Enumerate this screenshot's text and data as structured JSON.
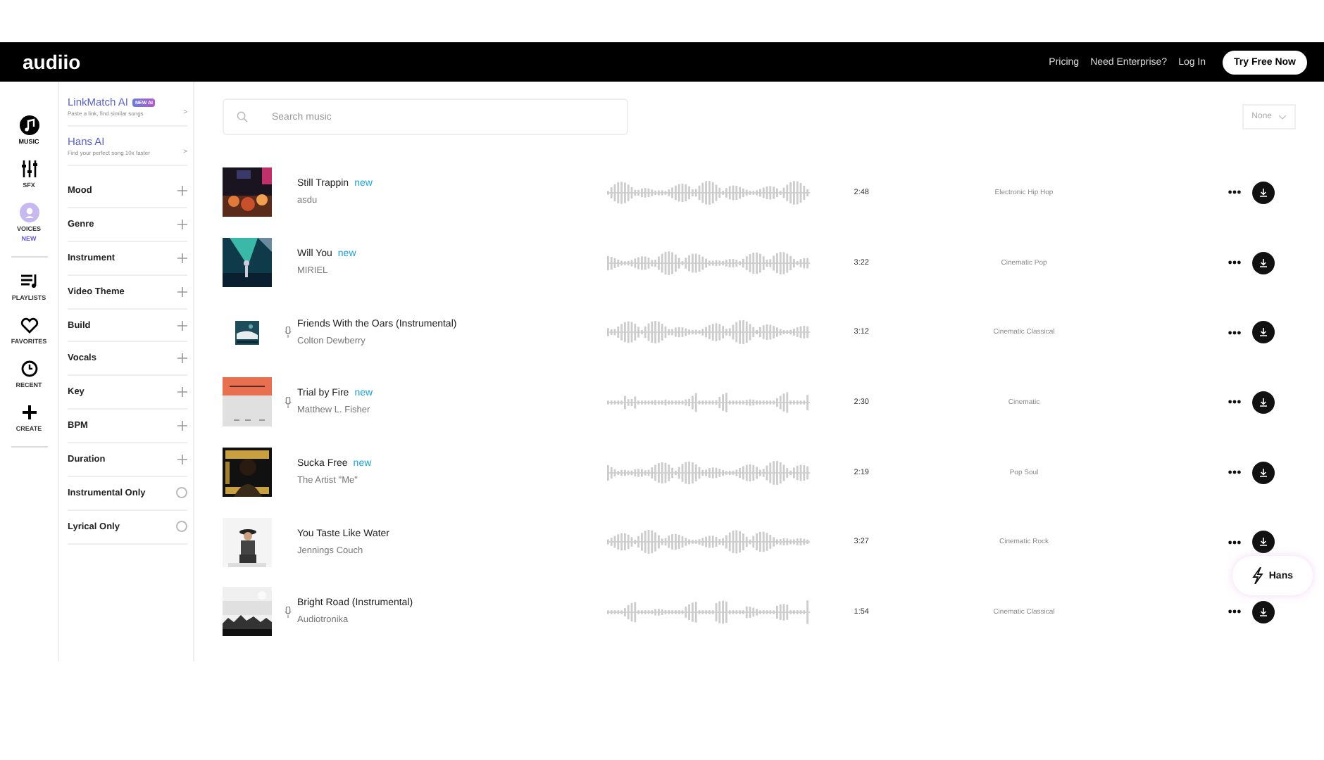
{
  "header": {
    "logo": "audiio",
    "links": [
      "Pricing",
      "Need Enterprise?",
      "Log In"
    ],
    "cta": "Try Free Now"
  },
  "nav_rail": [
    {
      "label": "MUSIC",
      "selected": true
    },
    {
      "label": "SFX",
      "selected": false
    },
    {
      "label": "VOICES",
      "selected": false,
      "tag": "NEW"
    },
    {
      "label": "PLAYLISTS",
      "selected": false
    },
    {
      "label": "FAVORITES",
      "selected": false
    },
    {
      "label": "RECENT",
      "selected": false
    },
    {
      "label": "CREATE",
      "selected": false
    }
  ],
  "ai_tools": [
    {
      "title": "LinkMatch AI",
      "badge": "NEW AI",
      "subtitle": "Paste a link, find similar songs",
      "chevron": ">"
    },
    {
      "title": "Hans AI",
      "subtitle": "Find your perfect song 10x faster",
      "chevron": ">"
    }
  ],
  "filters": [
    {
      "label": "Mood",
      "kind": "expand"
    },
    {
      "label": "Genre",
      "kind": "expand"
    },
    {
      "label": "Instrument",
      "kind": "expand"
    },
    {
      "label": "Video Theme",
      "kind": "expand"
    },
    {
      "label": "Build",
      "kind": "expand"
    },
    {
      "label": "Vocals",
      "kind": "expand"
    },
    {
      "label": "Key",
      "kind": "expand"
    },
    {
      "label": "BPM",
      "kind": "expand"
    },
    {
      "label": "Duration",
      "kind": "expand"
    },
    {
      "label": "Instrumental Only",
      "kind": "toggle",
      "on": false
    },
    {
      "label": "Lyrical Only",
      "kind": "toggle",
      "on": false
    }
  ],
  "search": {
    "placeholder": "Search music"
  },
  "sort": {
    "value": "None"
  },
  "tracks": [
    {
      "title": "Still Trappin",
      "tag": "new",
      "mic": false,
      "artist": "asdu",
      "duration": "2:48",
      "genre": "Electronic Hip Hop"
    },
    {
      "title": "Will You",
      "tag": "new",
      "mic": false,
      "artist": "MIRIEL",
      "duration": "3:22",
      "genre": "Cinematic Pop"
    },
    {
      "title": "Friends With the Oars (Instrumental)",
      "mic": true,
      "artist": "Colton Dewberry",
      "duration": "3:12",
      "genre": "Cinematic Classical"
    },
    {
      "title": "Trial by Fire",
      "tag": "new",
      "mic": true,
      "artist": "Matthew L. Fisher",
      "duration": "2:30",
      "genre": "Cinematic"
    },
    {
      "title": "Sucka Free",
      "tag": "new",
      "mic": false,
      "artist": "The Artist \"Me\"",
      "duration": "2:19",
      "genre": "Pop Soul"
    },
    {
      "title": "You Taste Like Water",
      "mic": false,
      "artist": "Jennings Couch",
      "duration": "3:27",
      "genre": "Cinematic Rock"
    },
    {
      "title": "Bright Road (Instrumental)",
      "mic": true,
      "artist": "Audiotronika",
      "duration": "1:54",
      "genre": "Cinematic Classical"
    }
  ],
  "assistant_button": {
    "label": "Hans"
  }
}
